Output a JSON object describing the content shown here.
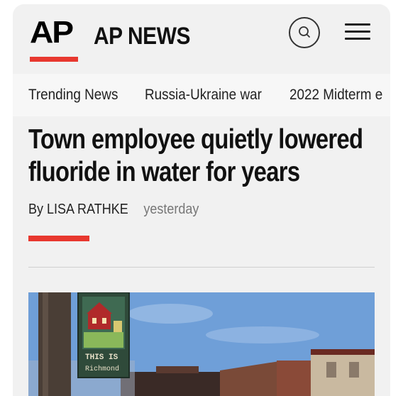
{
  "header": {
    "logo": "AP",
    "brand": "AP NEWS"
  },
  "nav": {
    "items": [
      "Trending News",
      "Russia-Ukraine war",
      "2022 Midterm e"
    ]
  },
  "article": {
    "headline": "Town employee quietly lowered fluoride in water for years",
    "author": "By LISA RATHKE",
    "time": "yesterday",
    "photo": {
      "sign_line1": "THIS IS",
      "sign_line2": "Richmond"
    }
  },
  "colors": {
    "accent": "#e8382f",
    "background": "#f1f1f1",
    "sky": "#6f9fd8"
  },
  "icons": [
    "search-icon",
    "menu-icon"
  ]
}
